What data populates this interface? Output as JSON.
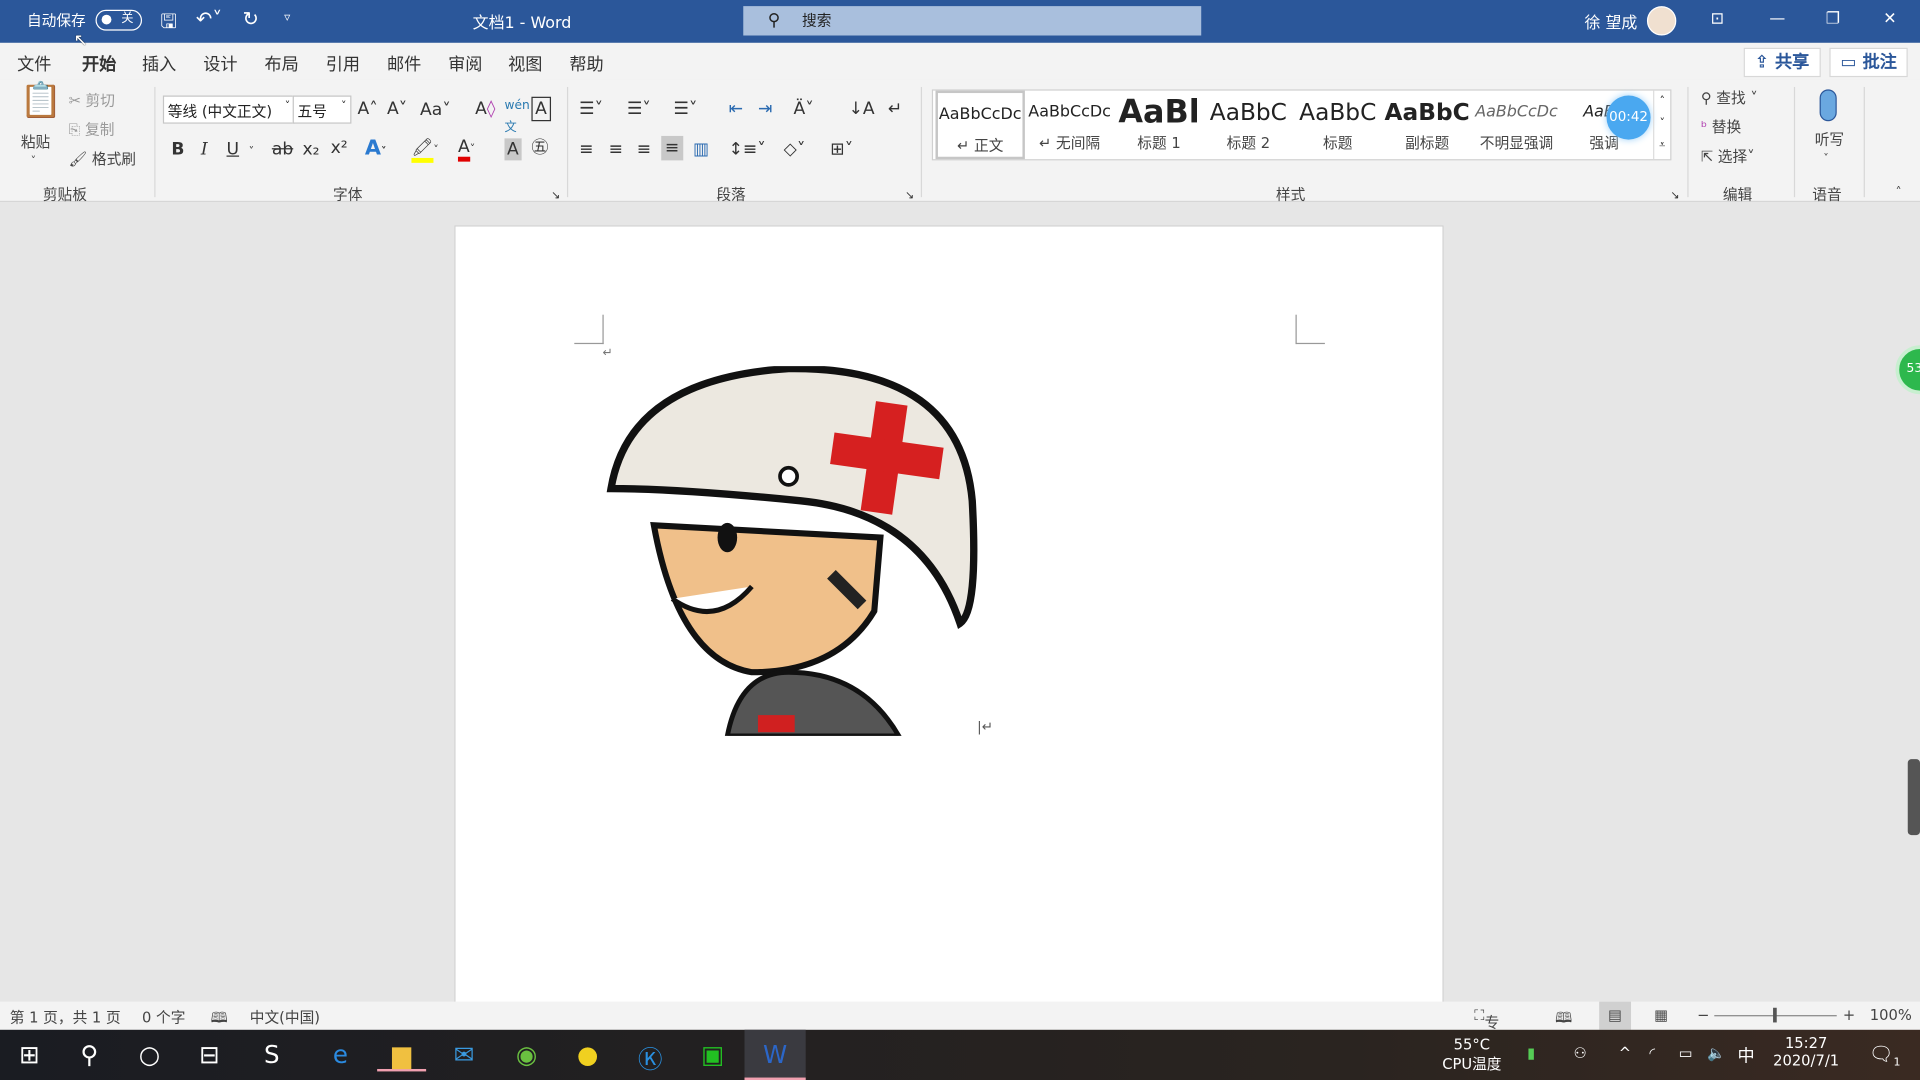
{
  "titlebar": {
    "autosave_label": "自动保存",
    "autosave_state": "关",
    "doc_title": "文档1  -  Word",
    "search_placeholder": "搜索",
    "user_name": "徐 望成",
    "quick_access": [
      "save-icon",
      "undo-icon",
      "redo-icon",
      "customize-icon"
    ]
  },
  "tabs": [
    "文件",
    "开始",
    "插入",
    "设计",
    "布局",
    "引用",
    "邮件",
    "审阅",
    "视图",
    "帮助"
  ],
  "active_tab": "开始",
  "share_label": "共享",
  "comments_label": "批注",
  "clipboard": {
    "paste": "粘贴",
    "cut": "剪切",
    "copy": "复制",
    "format_painter": "格式刷",
    "group": "剪贴板"
  },
  "font": {
    "name": "等线 (中文正文)",
    "size": "五号",
    "group": "字体",
    "aa": "Aa",
    "bold": "B",
    "italic": "I",
    "underline": "U",
    "strike": "ab",
    "sub": "x₂",
    "sup": "x²",
    "highlight_color": "#ffff00",
    "font_color": "#e00000"
  },
  "paragraph": {
    "group": "段落"
  },
  "styles": {
    "group": "样式",
    "items": [
      {
        "preview": "AaBbCcDc",
        "label": "↵ 正文"
      },
      {
        "preview": "AaBbCcDc",
        "label": "↵ 无间隔"
      },
      {
        "preview": "AaBl",
        "label": "标题 1"
      },
      {
        "preview": "AaBbC",
        "label": "标题 2"
      },
      {
        "preview": "AaBbC",
        "label": "标题"
      },
      {
        "preview": "AaBbC",
        "label": "副标题"
      },
      {
        "preview": "AaBbCcDc",
        "label": "不明显强调"
      },
      {
        "preview": "AaBb",
        "label": "强调"
      }
    ],
    "timer": "00:42"
  },
  "editing": {
    "find": "查找",
    "replace": "替换",
    "select": "选择",
    "group": "编辑"
  },
  "voice": {
    "dictate": "听写",
    "group": "语音"
  },
  "side_badge": "53",
  "status": {
    "page": "第 1 页，共 1 页",
    "words": "0 个字",
    "language": "中文(中国)",
    "focus": "专注",
    "zoom": "100%"
  },
  "taskbar": {
    "cpu_temp": "55°C",
    "cpu_label": "CPU温度",
    "ime": "中",
    "time": "15:27",
    "date": "2020/7/1",
    "notif_count": "1"
  },
  "colors": {
    "accent": "#2b579a"
  }
}
